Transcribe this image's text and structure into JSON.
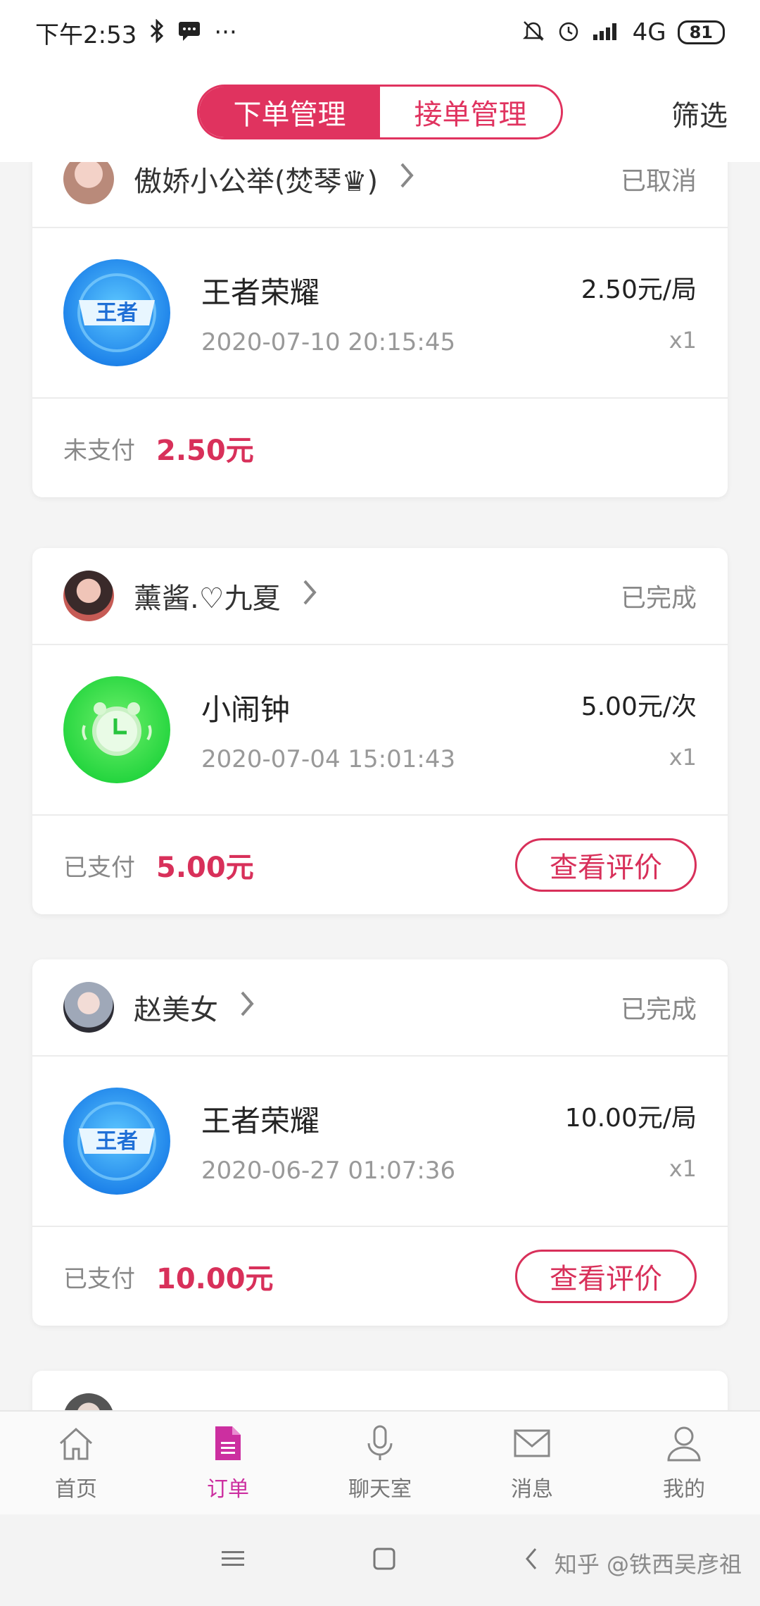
{
  "status_bar": {
    "time": "下午2:53",
    "bluetooth_icon": "bluetooth-icon",
    "message_icon": "message-icon",
    "more_dots": "···",
    "network": "4G",
    "battery": "81"
  },
  "header": {
    "tabs": [
      {
        "label": "下单管理",
        "active": true
      },
      {
        "label": "接单管理",
        "active": false
      }
    ],
    "filter_label": "筛选"
  },
  "orders": [
    {
      "seller": "傲娇小公举(焚琴♛)",
      "status": "已取消",
      "game": "王者荣耀",
      "time": "2020-07-10 20:15:45",
      "price": "2.50元/局",
      "qty": "x1",
      "pay_status": "未支付",
      "amount": "2.50元",
      "review_label": ""
    },
    {
      "seller": "薰酱.♡九夏",
      "status": "已完成",
      "game": "小闹钟",
      "time": "2020-07-04 15:01:43",
      "price": "5.00元/次",
      "qty": "x1",
      "pay_status": "已支付",
      "amount": "5.00元",
      "review_label": "查看评价"
    },
    {
      "seller": "赵美女",
      "status": "已完成",
      "game": "王者荣耀",
      "time": "2020-06-27 01:07:36",
      "price": "10.00元/局",
      "qty": "x1",
      "pay_status": "已支付",
      "amount": "10.00元",
      "review_label": "查看评价"
    }
  ],
  "game_icon_text": "王者",
  "bottom_nav": [
    {
      "label": "首页",
      "icon": "home-icon",
      "active": false
    },
    {
      "label": "订单",
      "icon": "order-icon",
      "active": true
    },
    {
      "label": "聊天室",
      "icon": "microphone-icon",
      "active": false
    },
    {
      "label": "消息",
      "icon": "mail-icon",
      "active": false
    },
    {
      "label": "我的",
      "icon": "user-icon",
      "active": false
    }
  ],
  "watermark": "知乎 @铁西吴彦祖",
  "colors": {
    "accent": "#e0335f",
    "amount": "#d8305a",
    "nav_active": "#cc2fa0"
  }
}
